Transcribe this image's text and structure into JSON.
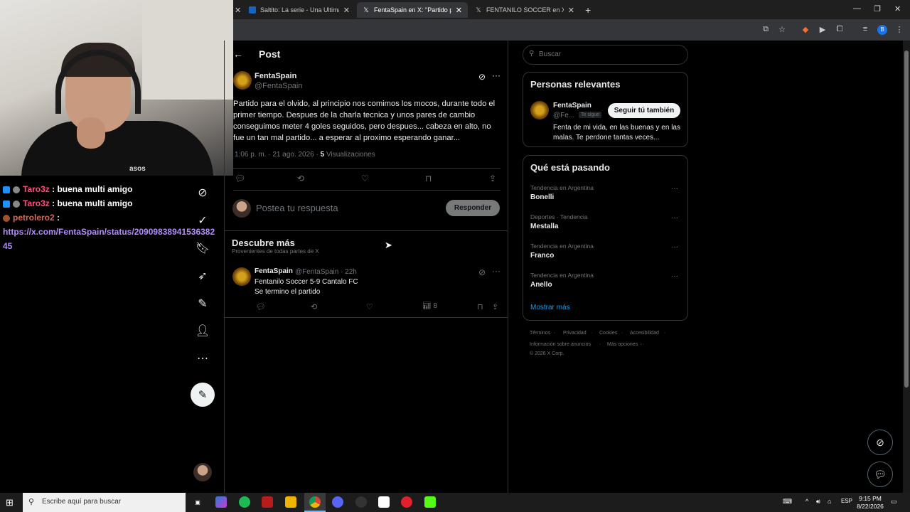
{
  "browser": {
    "tabs": [
      {
        "title": "Saltito: La serie - Una Ultima Es",
        "icon": "video-icon",
        "active": false
      },
      {
        "title": "FentaSpain en X: \"Partido para",
        "icon": "x-logo-icon",
        "active": true
      },
      {
        "title": "FENTANILO SOCCER en X: \"Fina",
        "icon": "x-logo-icon",
        "active": false
      }
    ],
    "new_tab": "+"
  },
  "chat": {
    "messages": [
      {
        "user": "Taro3z",
        "text": " : buena multi amigo"
      },
      {
        "user": "Taro3z",
        "text": " : buena multi amigo"
      },
      {
        "user": "petrolero2",
        "text": " :"
      }
    ],
    "link": "https://x.com/FentaSpain/status/2090983894153638245"
  },
  "webcam": {
    "shirt_text": "asos"
  },
  "post": {
    "header": "Post",
    "author_name": "FentaSpain",
    "author_handle": "@FentaSpain",
    "text": "Partido para el olvido, al principio nos comimos los mocos, durante todo el primer tiempo. Despues de la charla tecnica y unos pares de cambio conseguimos meter 4 goles seguidos, pero despues... cabeza en alto, no fue un tan mal partido... a esperar al proximo esperando ganar...",
    "time": "1:06 p. m. · 21 ago. 2026 · ",
    "views_count": "5",
    "views_label": " Visualizaciones"
  },
  "reply": {
    "placeholder": "Postea tu respuesta",
    "button": "Responder"
  },
  "discover": {
    "title": "Descubre más",
    "subtitle": "Provenientes de todas partes de X",
    "tweet": {
      "author": "FentaSpain",
      "handle_time": "@FentaSpain · 22h",
      "line1": "Fentanilo Soccer 5-9 Cantalo FC",
      "line2": "Se termino el partido",
      "views": "8"
    }
  },
  "search": {
    "placeholder": "Buscar"
  },
  "relevant": {
    "title": "Personas relevantes",
    "name": "FentaSpain",
    "handle": "@Fe...",
    "badge": "Te sigue",
    "follow": "Seguir tú también",
    "bio": "Fenta de mi vida, en las buenas y en las malas. Te perdone tantas veces..."
  },
  "trends": {
    "title": "Qué está pasando",
    "items": [
      {
        "meta": "Tendencia en Argentina",
        "name": "Bonelli"
      },
      {
        "meta": "Deportes · Tendencia",
        "name": "Mestalla"
      },
      {
        "meta": "Tendencia en Argentina",
        "name": "Franco"
      },
      {
        "meta": "Tendencia en Argentina",
        "name": "Anello"
      }
    ],
    "show_more": "Mostrar más"
  },
  "footer": {
    "terms": "Términos",
    "privacy": "Privacidad",
    "cookies": "Cookies",
    "accessibility": "Accesibilidad",
    "ads_info": "Información sobre anuncios",
    "more": "Más opciones ···",
    "copyright": "© 2026 X Corp."
  },
  "taskbar": {
    "search_placeholder": "Escribe aquí para buscar",
    "lang": "ESP",
    "time": "9:15 PM",
    "date": "8/22/2026"
  }
}
